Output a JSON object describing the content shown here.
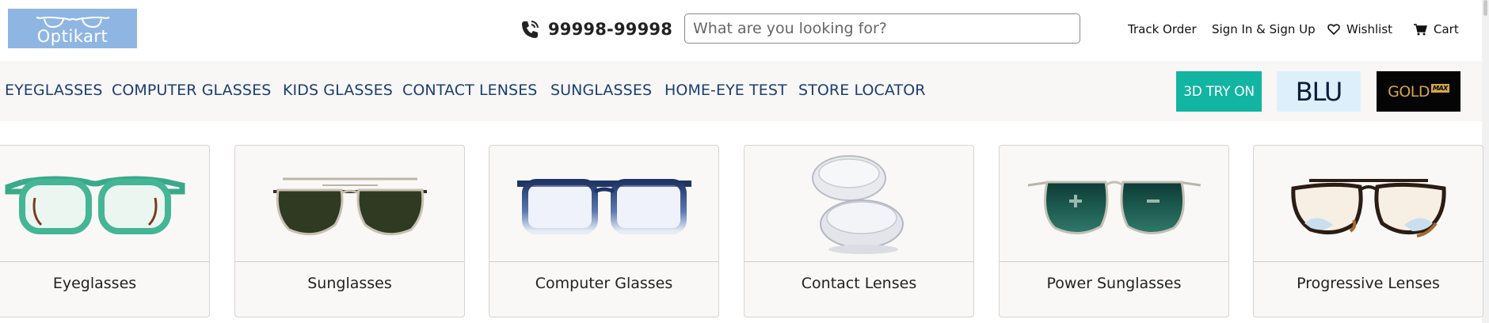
{
  "brand": {
    "logo_text": "Optikart"
  },
  "header": {
    "phone": "99998-99998",
    "search_placeholder": "What are you looking for?",
    "links": {
      "track_order": "Track Order",
      "sign_in": "Sign In & Sign Up",
      "wishlist": "Wishlist",
      "cart": "Cart"
    }
  },
  "nav": {
    "items": [
      "EYEGLASSES",
      "COMPUTER GLASSES",
      "KIDS GLASSES",
      "CONTACT LENSES",
      "SUNGLASSES",
      "HOME-EYE TEST",
      "STORE LOCATOR"
    ],
    "promo": {
      "try_on": "3D TRY ON",
      "blu": "BLU",
      "gold": "GOLD",
      "gold_tag": "MAX"
    }
  },
  "categories": [
    {
      "label": "Eyeglasses",
      "icon": "green-eyeglasses-image"
    },
    {
      "label": "Sunglasses",
      "icon": "aviator-sunglasses-image"
    },
    {
      "label": "Computer Glasses",
      "icon": "blue-computer-glasses-image"
    },
    {
      "label": "Contact Lenses",
      "icon": "contact-lenses-image"
    },
    {
      "label": "Power Sunglasses",
      "icon": "power-sunglasses-image"
    },
    {
      "label": "Progressive Lenses",
      "icon": "progressive-lenses-image"
    }
  ],
  "colors": {
    "logo_bg": "#8fb6e2",
    "nav_text": "#1a3f71",
    "nav_bg": "#f8f7f5",
    "try_on_bg": "#12b5a1",
    "blu_bg": "#dcf0fb",
    "gold_bg": "#050505",
    "gold_text": "#d4a64b"
  }
}
